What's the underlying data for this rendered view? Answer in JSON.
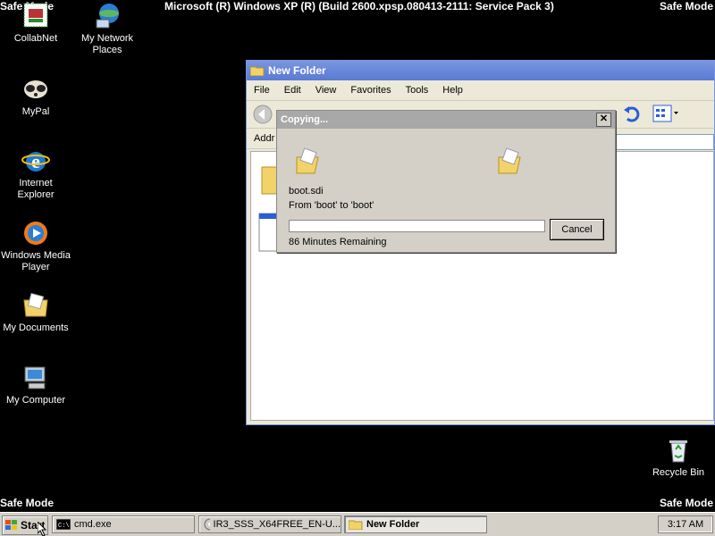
{
  "screen": {
    "os_title": "Microsoft (R) Windows XP (R) (Build 2600.xpsp.080413-2111: Service Pack 3)",
    "safe_mode_label": "Safe Mode"
  },
  "desktop_icons": [
    {
      "label": "CollabNet",
      "icon": "collabnet-icon"
    },
    {
      "label": "My Network Places",
      "icon": "network-places-icon"
    },
    {
      "label": "MyPal",
      "icon": "mypal-icon"
    },
    {
      "label": "Internet Explorer",
      "icon": "internet-explorer-icon"
    },
    {
      "label": "Windows Media Player",
      "icon": "media-player-icon"
    },
    {
      "label": "My Documents",
      "icon": "my-documents-icon"
    },
    {
      "label": "My Computer",
      "icon": "my-computer-icon"
    },
    {
      "label": "Recycle Bin",
      "icon": "recycle-bin-icon"
    }
  ],
  "explorer": {
    "title": "New Folder",
    "menu": [
      "File",
      "Edit",
      "View",
      "Favorites",
      "Tools",
      "Help"
    ],
    "address_label": "Addr"
  },
  "copy_dialog": {
    "title": "Copying...",
    "file_name": "boot.sdi",
    "from_to": "From 'boot' to 'boot'",
    "remaining": "86 Minutes Remaining",
    "progress": 0,
    "cancel_label": "Cancel"
  },
  "taskbar": {
    "start_label": "Start",
    "tasks": [
      {
        "label": "cmd.exe"
      },
      {
        "label": "IR3_SSS_X64FREE_EN-U..."
      },
      {
        "label": "New Folder"
      }
    ],
    "clock": "3:17 AM"
  },
  "colors": {
    "desktop": "#000000",
    "title_bar_active": "#7A96DF",
    "dialog_title_inactive": "#A8A8A8"
  }
}
